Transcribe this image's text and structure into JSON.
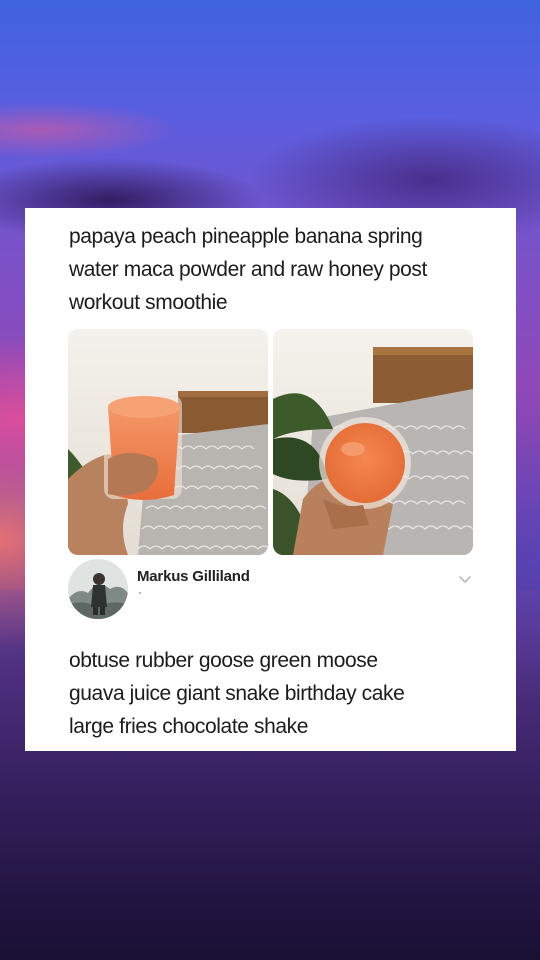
{
  "post": {
    "caption": "papaya peach pineapple banana spring water maca powder and raw honey post workout smoothie",
    "caption_lines": [
      "papaya peach pineapple banana spring",
      "water maca powder and raw honey post",
      "workout smoothie"
    ],
    "images": [
      {
        "name": "smoothie-photo-left"
      },
      {
        "name": "smoothie-photo-right"
      }
    ]
  },
  "reply": {
    "author": "Markus Gilliland",
    "body_lines": [
      "obtuse rubber goose green moose",
      "guava juice giant snake birthday cake",
      "large fries chocolate shake"
    ]
  },
  "icons": {
    "menu": "chevron-down-icon"
  },
  "colors": {
    "card_background": "#ffffff",
    "text": "#1c1c1c",
    "smoothie": "#f07a48"
  }
}
